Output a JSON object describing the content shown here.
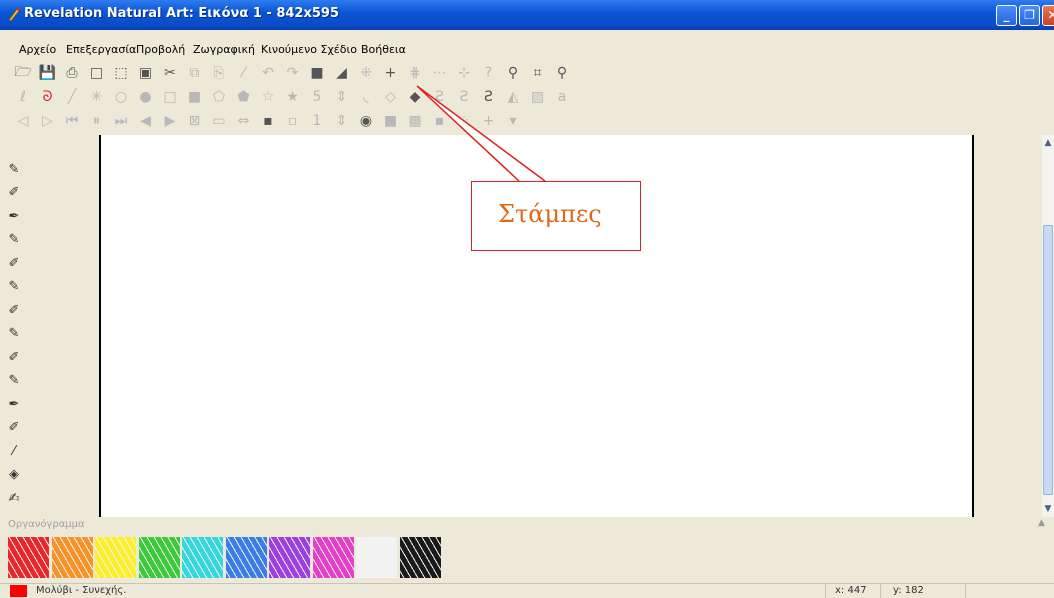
{
  "window": {
    "title": "Revelation Natural Art: Εικόνα 1 - 842x595"
  },
  "menu": [
    "Αρχείο",
    "Επεξεργασία",
    "Προβολή",
    "Ζωγραφική",
    "Κινούμενο Σχέδιο",
    "Βοήθεια"
  ],
  "toolbar": {
    "row1": [
      {
        "name": "open-icon",
        "glyph": "🗁",
        "state": "normal"
      },
      {
        "name": "save-icon",
        "glyph": "💾",
        "state": "normal"
      },
      {
        "name": "print-icon",
        "glyph": "⎙",
        "state": "normal"
      },
      {
        "name": "new-page-icon",
        "glyph": "□",
        "state": "normal"
      },
      {
        "name": "select-icon",
        "glyph": "⬚",
        "state": "normal"
      },
      {
        "name": "layers-icon",
        "glyph": "▣",
        "state": "normal"
      },
      {
        "name": "cut-icon",
        "glyph": "✂",
        "state": "normal"
      },
      {
        "name": "copy-icon",
        "glyph": "⧉",
        "state": "dim"
      },
      {
        "name": "paste-icon",
        "glyph": "⎘",
        "state": "dim"
      },
      {
        "name": "brush-icon",
        "glyph": "⁄",
        "state": "dim"
      },
      {
        "name": "undo-icon",
        "glyph": "↶",
        "state": "dim"
      },
      {
        "name": "redo-icon",
        "glyph": "↷",
        "state": "dim"
      },
      {
        "name": "gradient-icon",
        "glyph": "■",
        "state": "normal"
      },
      {
        "name": "texture-icon",
        "glyph": "◢",
        "state": "normal"
      },
      {
        "name": "stamp-icon",
        "glyph": "⁜",
        "state": "dim"
      },
      {
        "name": "crosshair-icon",
        "glyph": "+",
        "state": "normal"
      },
      {
        "name": "symmetry-v-icon",
        "glyph": "⋕",
        "state": "dim"
      },
      {
        "name": "symmetry-h-icon",
        "glyph": "⋯",
        "state": "dim"
      },
      {
        "name": "symmetry-icon",
        "glyph": "⊹",
        "state": "dim"
      },
      {
        "name": "help-icon",
        "glyph": "?",
        "state": "dim"
      },
      {
        "name": "stamp-tool-icon",
        "glyph": "⚲",
        "state": "normal"
      },
      {
        "name": "crop-icon",
        "glyph": "⌗",
        "state": "normal"
      },
      {
        "name": "zoom-icon",
        "glyph": "⚲",
        "state": "normal"
      }
    ],
    "row2": [
      {
        "name": "lasso-icon",
        "glyph": "ℓ",
        "state": "dim"
      },
      {
        "name": "freehand-icon",
        "glyph": "ᘐ",
        "state": "red"
      },
      {
        "name": "line-icon",
        "glyph": "╱",
        "state": "dim"
      },
      {
        "name": "star-burst-icon",
        "glyph": "✳",
        "state": "dim"
      },
      {
        "name": "circle-outline-icon",
        "glyph": "○",
        "state": "dim"
      },
      {
        "name": "circle-filled-icon",
        "glyph": "●",
        "state": "dim"
      },
      {
        "name": "rect-outline-icon",
        "glyph": "□",
        "state": "dim"
      },
      {
        "name": "rect-filled-icon",
        "glyph": "■",
        "state": "dim"
      },
      {
        "name": "pentagon-outline-icon",
        "glyph": "⬠",
        "state": "dim"
      },
      {
        "name": "pentagon-filled-icon",
        "glyph": "⬟",
        "state": "dim"
      },
      {
        "name": "star-outline-icon",
        "glyph": "☆",
        "state": "dim"
      },
      {
        "name": "star-filled-icon",
        "glyph": "★",
        "state": "dim"
      },
      {
        "name": "sides-value",
        "glyph": "5",
        "state": "dim"
      },
      {
        "name": "sides-spinner-icon",
        "glyph": "⇕",
        "state": "dim"
      },
      {
        "name": "arc-icon",
        "glyph": "◟",
        "state": "dim"
      },
      {
        "name": "blob-icon",
        "glyph": "◇",
        "state": "dim"
      },
      {
        "name": "shape-icon",
        "glyph": "◆",
        "state": "normal"
      },
      {
        "name": "curve-outline-icon",
        "glyph": "Ƨ",
        "state": "dim"
      },
      {
        "name": "curve-icon",
        "glyph": "Ƨ",
        "state": "dim"
      },
      {
        "name": "curve-filled-icon",
        "glyph": "Ƨ",
        "state": "normal"
      },
      {
        "name": "fill-icon",
        "glyph": "◭",
        "state": "dim"
      },
      {
        "name": "image-icon",
        "glyph": "▨",
        "state": "dim"
      },
      {
        "name": "text-icon",
        "glyph": "a",
        "state": "dim"
      }
    ],
    "row3": [
      {
        "name": "prev-frame-icon",
        "glyph": "◁",
        "state": "dim"
      },
      {
        "name": "next-frame-icon",
        "glyph": "▷",
        "state": "dim"
      },
      {
        "name": "rewind-icon",
        "glyph": "⏮",
        "state": "dim"
      },
      {
        "name": "pause-icon",
        "glyph": "⏸",
        "state": "dim"
      },
      {
        "name": "forward-icon",
        "glyph": "⏭",
        "state": "dim"
      },
      {
        "name": "onion-back-icon",
        "glyph": "◀",
        "state": "dim"
      },
      {
        "name": "onion-forward-icon",
        "glyph": "▶",
        "state": "dim"
      },
      {
        "name": "frame-cross-icon",
        "glyph": "⊠",
        "state": "dim"
      },
      {
        "name": "frame-list-icon",
        "glyph": "▭",
        "state": "dim"
      },
      {
        "name": "frame-move-icon",
        "glyph": "⇔",
        "state": "dim"
      },
      {
        "name": "frame-copy-icon",
        "glyph": "▪",
        "state": "normal"
      },
      {
        "name": "frame-blank-icon",
        "glyph": "▫",
        "state": "dim"
      },
      {
        "name": "brush-size-value",
        "glyph": "1",
        "state": "dim"
      },
      {
        "name": "brush-size-spinner-icon",
        "glyph": "⇕",
        "state": "dim"
      },
      {
        "name": "brush-dot-icon",
        "glyph": "◉",
        "state": "normal"
      },
      {
        "name": "brush-square-icon",
        "glyph": "■",
        "state": "dim"
      },
      {
        "name": "brush-soft-icon",
        "glyph": "▩",
        "state": "dim"
      },
      {
        "name": "brush-small-icon",
        "glyph": "▪",
        "state": "dim"
      },
      {
        "name": "brush-dots-icon",
        "glyph": "⁘",
        "state": "dim"
      },
      {
        "name": "brush-cross-icon",
        "glyph": "+",
        "state": "dim"
      },
      {
        "name": "brush-dropdown-icon",
        "glyph": "▾",
        "state": "dim"
      }
    ]
  },
  "tools": [
    {
      "name": "pencil-tool-icon",
      "glyph": "✎"
    },
    {
      "name": "marker-tool-icon",
      "glyph": "✐"
    },
    {
      "name": "pen-tool-icon",
      "glyph": "✒"
    },
    {
      "name": "crayon-tool-icon",
      "glyph": "✎"
    },
    {
      "name": "brush-tool-icon",
      "glyph": "✐"
    },
    {
      "name": "chalk-tool-icon",
      "glyph": "✎"
    },
    {
      "name": "pastel-tool-icon",
      "glyph": "✐"
    },
    {
      "name": "charcoal-tool-icon",
      "glyph": "✎"
    },
    {
      "name": "airbrush-tool-icon",
      "glyph": "✐"
    },
    {
      "name": "oil-tool-icon",
      "glyph": "✎"
    },
    {
      "name": "ink-tool-icon",
      "glyph": "✒"
    },
    {
      "name": "smudge-tool-icon",
      "glyph": "✐"
    },
    {
      "name": "knife-tool-icon",
      "glyph": "⁄"
    },
    {
      "name": "eraser-tool-icon",
      "glyph": "◈"
    },
    {
      "name": "feather-tool-icon",
      "glyph": "✍"
    }
  ],
  "panel": {
    "label": "Οργανόγραμμα"
  },
  "palette": [
    "#e8262b",
    "#f7922a",
    "#fbee2b",
    "#3cc93c",
    "#35d6df",
    "#3a7ce8",
    "#9a3fe0",
    "#e53ec8",
    "#f2f2f2",
    "#1a1a1a"
  ],
  "callout": {
    "label": "Στάμπες",
    "border_color": "#e02020",
    "text_color": "#e06818"
  },
  "status": {
    "tool_text": "Μολύβι - Συνεχής.",
    "x": "x: 447",
    "y": "y: 182",
    "color": "#ff0000"
  }
}
